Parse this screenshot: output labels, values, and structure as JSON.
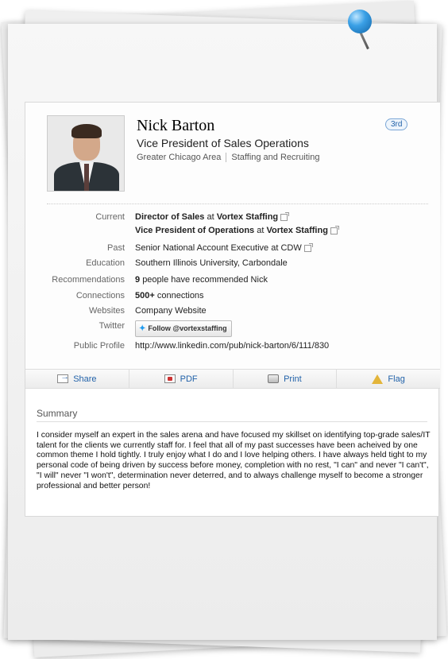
{
  "profile": {
    "name": "Nick Barton",
    "degree": "3rd",
    "headline": "Vice President of Sales Operations",
    "location": "Greater Chicago Area",
    "industry": "Staffing and Recruiting"
  },
  "details": {
    "current_label": "Current",
    "current_1_title": "Director of Sales",
    "current_1_at": "at",
    "current_1_company": "Vortex Staffing",
    "current_2_title": "Vice President of Operations",
    "current_2_at": "at",
    "current_2_company": "Vortex Staffing",
    "past_label": "Past",
    "past_value": "Senior National Account Executive at CDW",
    "education_label": "Education",
    "education_value": "Southern Illinois University, Carbondale",
    "recommendations_label": "Recommendations",
    "recommendations_count": "9",
    "recommendations_text": "people have recommended Nick",
    "connections_label": "Connections",
    "connections_count": "500+",
    "connections_text": "connections",
    "websites_label": "Websites",
    "websites_value": "Company Website",
    "twitter_label": "Twitter",
    "twitter_button": "Follow @vortexstaffing",
    "public_profile_label": "Public Profile",
    "public_profile_url": "http://www.linkedin.com/pub/nick-barton/6/111/830"
  },
  "actions": {
    "share": "Share",
    "pdf": "PDF",
    "print": "Print",
    "flag": "Flag"
  },
  "summary": {
    "heading": "Summary",
    "text": "I consider myself an expert in the sales arena and have focused my skillset on identifying top-grade sales/IT talent for the clients we currently staff for. I feel that all of my past successes have been acheived by one common theme I hold tightly. I truly enjoy what I do and I love helping others. I have always held tight to my personal code of being driven by success before money, completion with no rest, \"I can\" and never \"I can't\", \"I will\" never \"I won't\", determination never deterred, and to always challenge myself to become a stronger professional and better person!"
  },
  "colors": {
    "link": "#2262a9",
    "pin": "#3aa0e6"
  }
}
